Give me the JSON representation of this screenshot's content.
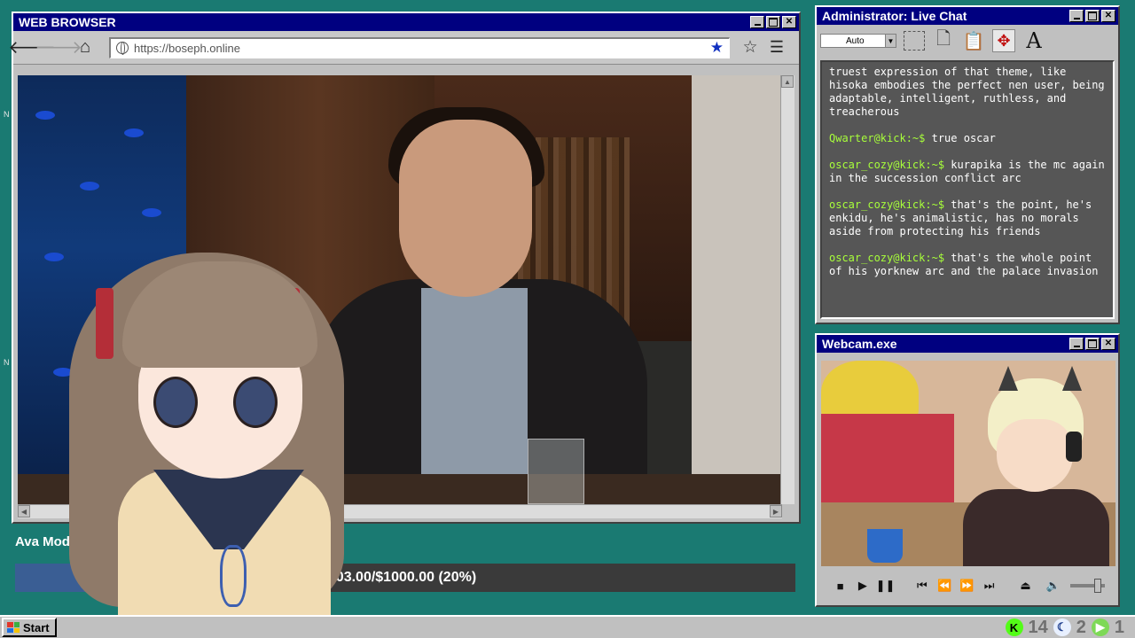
{
  "browser": {
    "title": "WEB BROWSER",
    "url": "https://boseph.online",
    "icons": {
      "back": "arrow-left-icon",
      "forward": "arrow-right-icon",
      "home": "home-icon",
      "bookmark": "star-filled-icon",
      "favorite": "star-outline-icon",
      "menu": "hamburger-icon"
    }
  },
  "stream": {
    "goal_label": "Ava Mod",
    "goal_text": "$203.00/$1000.00 (20%)",
    "goal_fraction": 0.203,
    "colors": {
      "fill": "#3a5e94",
      "track": "#3a3a3a"
    }
  },
  "chat": {
    "title": "Administrator: Live Chat",
    "zoom_select": "Auto",
    "tools": [
      "select-icon",
      "copy-icon",
      "paste-icon",
      "move-icon",
      "text-icon"
    ],
    "messages": [
      {
        "user": "",
        "text": "truest expression of that theme, like hisoka embodies the perfect nen user, being adaptable, intelligent, ruthless, and treacherous"
      },
      {
        "user": "Qwarter@kick:~$",
        "text": "true oscar"
      },
      {
        "user": "oscar_cozy@kick:~$",
        "text": "kurapika is the mc again in the succession conflict arc"
      },
      {
        "user": "oscar_cozy@kick:~$",
        "text": "that's the point, he's enkidu, he's animalistic, has no morals aside from protecting his friends"
      },
      {
        "user": "oscar_cozy@kick:~$",
        "text": "that's the whole point of his yorknew arc and the palace invasion"
      }
    ],
    "colors": {
      "username": "#a8ff3a",
      "background": "#565656"
    }
  },
  "webcam": {
    "title": "Webcam.exe",
    "controls": [
      "stop-icon",
      "play-icon",
      "pause-icon",
      "skip-back-icon",
      "rewind-icon",
      "fast-forward-icon",
      "skip-forward-icon",
      "eject-icon",
      "volume-icon"
    ]
  },
  "taskbar": {
    "start_label": "Start",
    "tray": [
      {
        "icon": "kick-icon",
        "count": "14",
        "color": "#53fc18"
      },
      {
        "icon": "moon-icon",
        "count": "2",
        "color": "#e8f0ff"
      },
      {
        "icon": "play-circle-icon",
        "count": "1",
        "color": "#7ed957"
      }
    ]
  },
  "titlebar_color": "#000080",
  "desktop_color": "#1a7a72"
}
